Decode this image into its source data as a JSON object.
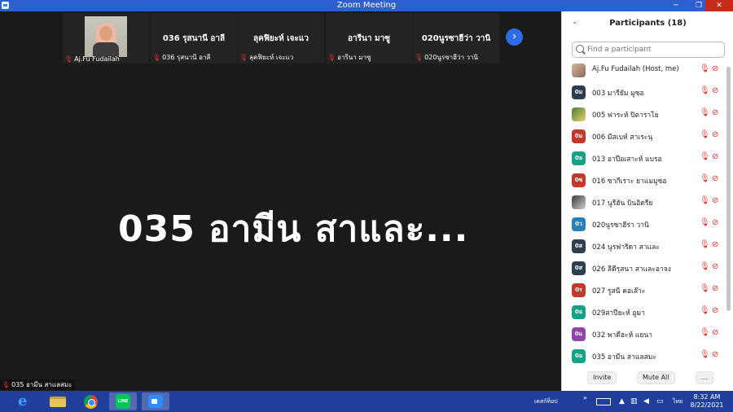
{
  "window": {
    "title": "Zoom Meeting",
    "minimize": "─",
    "maximize": "❐",
    "close": "✕"
  },
  "gallery": {
    "tiles": [
      {
        "name": "",
        "label": "Aj.Fu Fudailah",
        "has_photo": true
      },
      {
        "name": "036 รุสนานี อาลี",
        "label": "036 รุสนานี อาลี"
      },
      {
        "name": "ลุคฟิยะห์ เจะแว",
        "label": "ลุคฟิยะห์ เจะแว"
      },
      {
        "name": "อารีนา มาซู",
        "label": "อารีนา มาซู"
      },
      {
        "name": "020นูรซาฮีว่า วานิ",
        "label": "020นูรซาฮีว่า วานิ"
      }
    ],
    "next_arrow": "›"
  },
  "active_speaker": {
    "name": "035 อามีน สาและ..."
  },
  "self_label": "035 อามีน สาแลสมะ",
  "participants_panel": {
    "collapse": "⌄",
    "title": "Participants (18)",
    "search_placeholder": "Find a participant",
    "participants": [
      {
        "initials": "",
        "name": "Aj.Fu Fudailah (Host, me)",
        "color": "",
        "photo": "a"
      },
      {
        "initials": "0ม",
        "name": "003 มารียัม มูซอ",
        "color": "#2c3e50"
      },
      {
        "initials": "",
        "name": "005 ฟาระห์ ปิตาราโย",
        "color": "",
        "photo": "b"
      },
      {
        "initials": "0ม",
        "name": "006 มีสเบห์ สาเระนุ",
        "color": "#c0392b"
      },
      {
        "initials": "0อ",
        "name": "013 อาปือเสาะห์ แบรอ",
        "color": "#16a085"
      },
      {
        "initials": "0ซ",
        "name": "016 ซากีเราะ ยาแมมูซอ",
        "color": "#c0392b"
      },
      {
        "initials": "",
        "name": "017 นูรีฮัน บินอิดรีย",
        "color": "",
        "photo": "c"
      },
      {
        "initials": "0ว",
        "name": "020นูรซาฮีร่า วานิ",
        "color": "#2980b9"
      },
      {
        "initials": "0ส",
        "name": "024 นูรฟาริดา สาและ",
        "color": "#2c3e50"
      },
      {
        "initials": "0ส",
        "name": "026 ลีดีรุสนา สาและอาจง",
        "color": "#2c3e50"
      },
      {
        "initials": "0ร",
        "name": "027 รูสนี คอเล๊าะ",
        "color": "#c0392b"
      },
      {
        "initials": "0อ",
        "name": "029สาปียะห์ อูมา",
        "color": "#16a085"
      },
      {
        "initials": "0แ",
        "name": "032 พาตีฮะห์ แยนา",
        "color": "#8e44ad"
      },
      {
        "initials": "0อ",
        "name": "035 อามีน สาแลสมะ",
        "color": "#16a085"
      }
    ],
    "footer": {
      "invite": "Invite",
      "mute_all": "Mute All",
      "more": "..."
    }
  },
  "taskbar": {
    "apps": [
      "internet-explorer",
      "file-explorer",
      "chrome",
      "line",
      "zoom"
    ],
    "line_label": "LINE",
    "tray_text": "เดสก์ท็อป",
    "language": "ไทย",
    "time": "8:32 AM",
    "date": "8/22/2021"
  }
}
